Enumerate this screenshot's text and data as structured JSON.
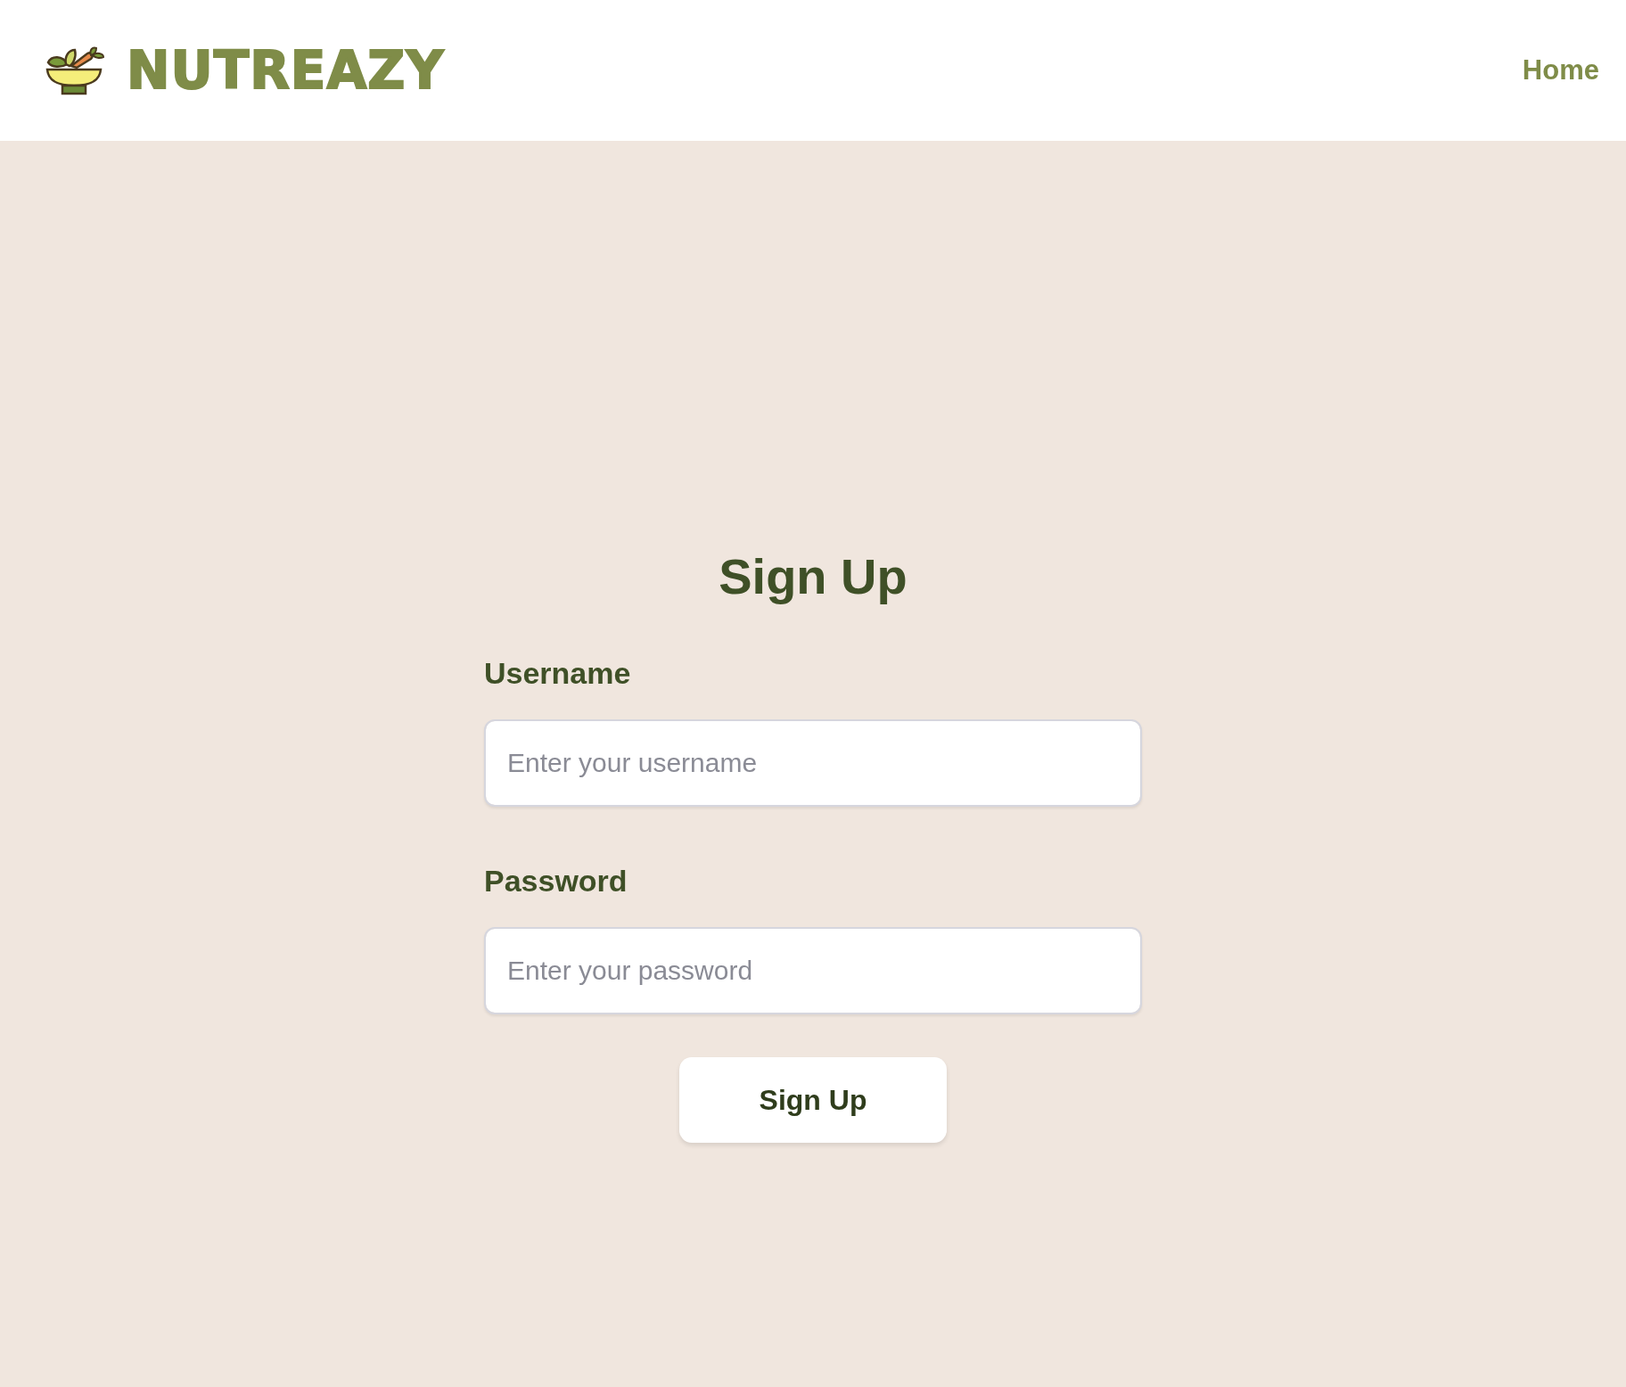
{
  "header": {
    "brand": "NUTREAZY",
    "nav_links": [
      "Home"
    ]
  },
  "form": {
    "title": "Sign Up",
    "fields": [
      {
        "label": "Username",
        "placeholder": "Enter your username"
      },
      {
        "label": "Password",
        "placeholder": "Enter your password"
      }
    ],
    "submit": "Sign Up"
  }
}
